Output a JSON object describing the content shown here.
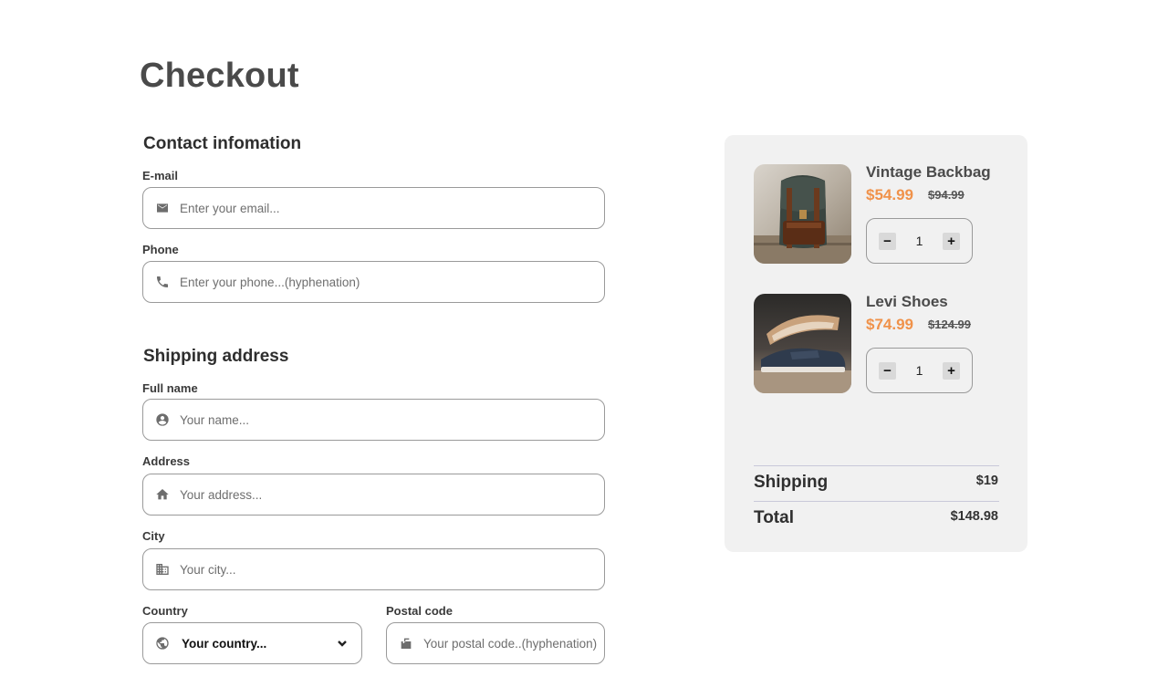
{
  "page": {
    "title": "Checkout"
  },
  "contact": {
    "title": "Contact infomation",
    "email": {
      "label": "E-mail",
      "placeholder": "Enter your email...",
      "icon": "mail-icon"
    },
    "phone": {
      "label": "Phone",
      "placeholder": "Enter your phone...(hyphenation)",
      "icon": "phone-icon"
    }
  },
  "shipping": {
    "title": "Shipping address",
    "full_name": {
      "label": "Full name",
      "placeholder": "Your name...",
      "icon": "person-icon"
    },
    "address": {
      "label": "Address",
      "placeholder": "Your address...",
      "icon": "home-icon"
    },
    "city": {
      "label": "City",
      "placeholder": "Your city...",
      "icon": "building-icon"
    },
    "country": {
      "label": "Country",
      "value": "Your country...",
      "icon": "globe-icon"
    },
    "postal": {
      "label": "Postal code",
      "placeholder": "Your postal code..(hyphenation)",
      "icon": "mailbox-icon"
    }
  },
  "cart": {
    "items": [
      {
        "name": "Vintage Backbag",
        "price": "$54.99",
        "old_price": "$94.99",
        "quantity": "1",
        "minus": "−",
        "plus": "+"
      },
      {
        "name": "Levi Shoes",
        "price": "$74.99",
        "old_price": "$124.99",
        "quantity": "1",
        "minus": "−",
        "plus": "+"
      }
    ],
    "shipping_label": "Shipping",
    "shipping_value": "$19",
    "total_label": "Total",
    "total_value": "$148.98"
  },
  "colors": {
    "accent_price": "#f0924a",
    "summary_bg": "#f1f1f1",
    "border": "#9a9a9a"
  }
}
